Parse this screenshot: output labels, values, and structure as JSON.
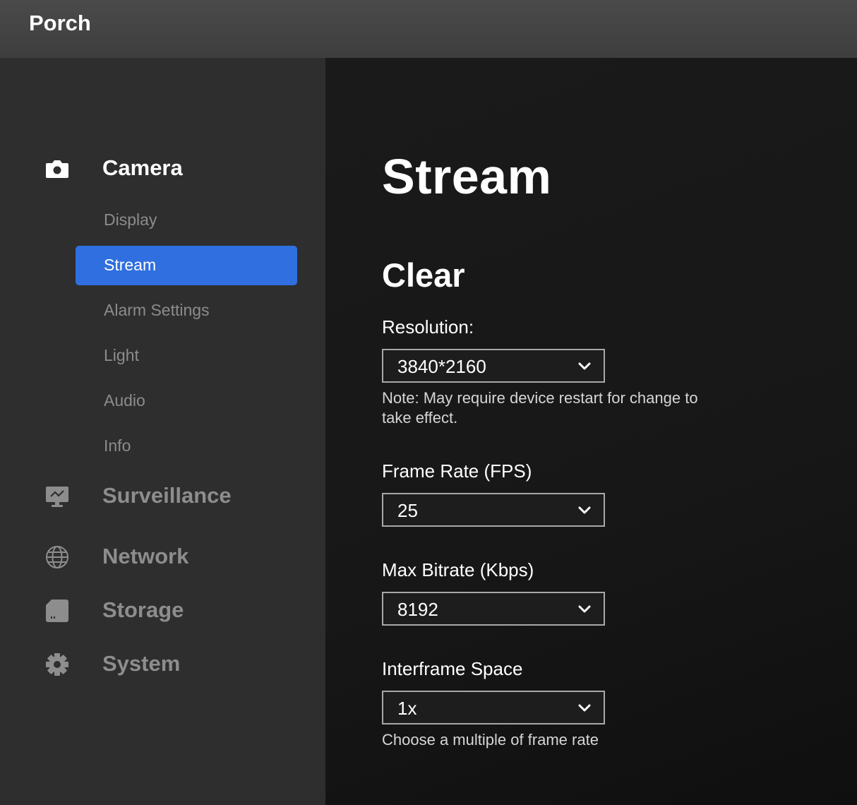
{
  "app": {
    "title": "Porch"
  },
  "sidebar": {
    "sections": [
      {
        "label": "Camera",
        "icon": "camera-icon",
        "active": true,
        "items": [
          {
            "label": "Display",
            "active": false
          },
          {
            "label": "Stream",
            "active": true
          },
          {
            "label": "Alarm Settings",
            "active": false
          },
          {
            "label": "Light",
            "active": false
          },
          {
            "label": "Audio",
            "active": false
          },
          {
            "label": "Info",
            "active": false
          }
        ]
      },
      {
        "label": "Surveillance",
        "icon": "monitor-icon",
        "active": false
      },
      {
        "label": "Network",
        "icon": "globe-icon",
        "active": false
      },
      {
        "label": "Storage",
        "icon": "sd-card-icon",
        "active": false
      },
      {
        "label": "System",
        "icon": "gear-icon",
        "active": false
      }
    ]
  },
  "main": {
    "title": "Stream",
    "subsection": "Clear",
    "fields": {
      "resolution": {
        "label": "Resolution:",
        "value": "3840*2160",
        "note": "Note: May require device restart for change to take effect."
      },
      "frame_rate": {
        "label": "Frame Rate (FPS)",
        "value": "25"
      },
      "max_bitrate": {
        "label": "Max Bitrate (Kbps)",
        "value": "8192"
      },
      "interframe_space": {
        "label": "Interframe Space",
        "value": "1x",
        "note": "Choose a multiple of frame rate"
      }
    }
  },
  "colors": {
    "accent": "#2f6fe0",
    "sidebar_bg": "#2e2e2e",
    "topbar_bg": "#444444",
    "main_bg": "#171717",
    "inactive_text": "#8d8d8d"
  }
}
